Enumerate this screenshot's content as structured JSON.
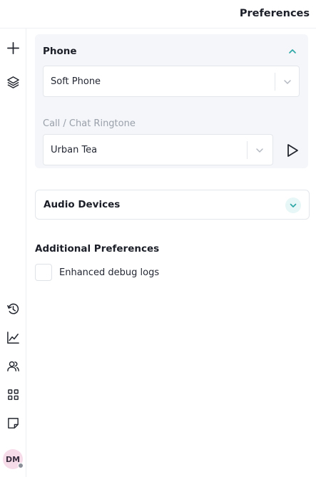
{
  "header": {
    "title": "Preferences"
  },
  "rail": {
    "top_icons": [
      "plus-icon",
      "layers-icon"
    ],
    "bottom_icons": [
      "history-icon",
      "analytics-icon",
      "contacts-icon",
      "apps-grid-icon",
      "notes-icon"
    ],
    "avatar": {
      "initials": "DM",
      "status": "offline"
    }
  },
  "phone": {
    "title": "Phone",
    "expanded": true,
    "mode": {
      "value": "Soft Phone"
    },
    "ringtone": {
      "label": "Call / Chat Ringtone",
      "value": "Urban Tea"
    }
  },
  "audio_devices": {
    "title": "Audio Devices",
    "expanded": false
  },
  "additional": {
    "title": "Additional Preferences",
    "debug_logs": {
      "label": "Enhanced debug logs",
      "checked": false
    }
  },
  "colors": {
    "accent": "#2aa7a5",
    "card_background": "#f4f6f9",
    "border": "#e3e6eb"
  }
}
